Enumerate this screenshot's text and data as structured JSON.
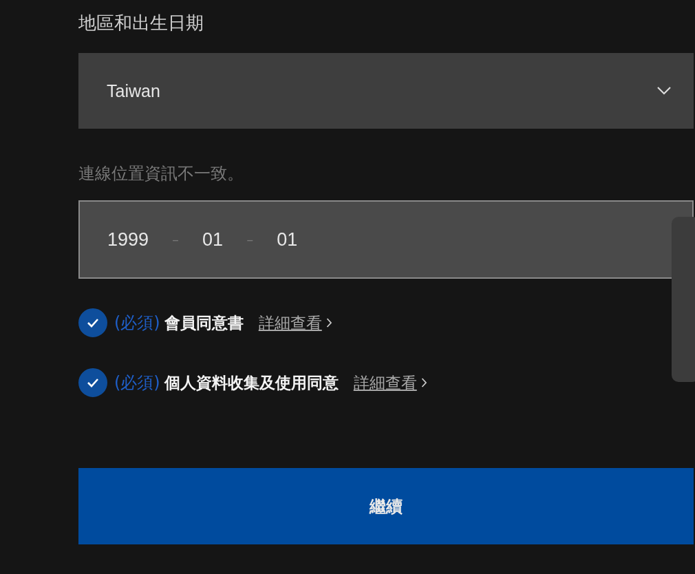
{
  "section_title": "地區和出生日期",
  "region_select": {
    "value": "Taiwan"
  },
  "location_notice": "連線位置資訊不一致。",
  "birth_date": [
    {
      "kind": "value",
      "text": "1999"
    },
    {
      "kind": "separator",
      "text": "–"
    },
    {
      "kind": "value",
      "text": "01"
    },
    {
      "kind": "separator",
      "text": "–"
    },
    {
      "kind": "value",
      "text": "01"
    }
  ],
  "agreements": [
    {
      "checked": true,
      "required": "(必須)",
      "label": "會員同意書",
      "link": "詳細查看"
    },
    {
      "checked": true,
      "required": "(必須)",
      "label": "個人資料收集及使用同意",
      "link": "詳細查看"
    }
  ],
  "continue_button": "繼續"
}
